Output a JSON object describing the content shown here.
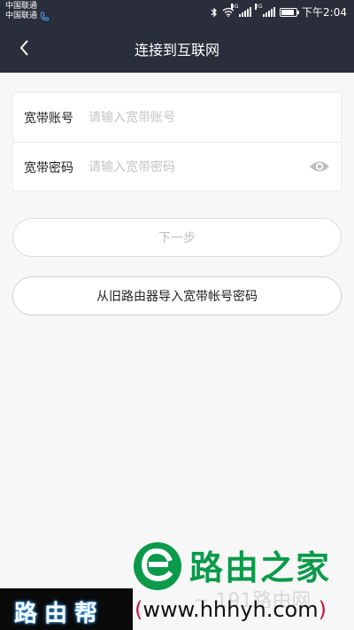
{
  "status_bar": {
    "carrier1": "中国联通",
    "carrier2": "中国联通",
    "sig1_tag": "4G",
    "sig2_tag": "2G",
    "battery_level": 0.9,
    "time": "下午2:04"
  },
  "header": {
    "title": "连接到互联网"
  },
  "form": {
    "account_label": "宽带账号",
    "account_placeholder": "请输入宽带账号",
    "account_value": "",
    "password_label": "宽带密码",
    "password_placeholder": "请输入宽带密码",
    "password_value": ""
  },
  "buttons": {
    "next_label": "下一步",
    "import_label": "从旧路由器导入宽带帐号密码"
  },
  "watermark": {
    "brand_cn": "路由之家",
    "left_brand": "路由帮",
    "url_open": "(",
    "url": "www.hhhyh.com",
    "url_close": ")",
    "ghost_text": "~ 191路由网"
  },
  "colors": {
    "bar_bg": "#2a2d3a",
    "brand_green": "#0a9a4a",
    "placeholder": "#c4c4c4"
  },
  "icons": {
    "back": "chevron-left-icon",
    "password_visibility": "eye-icon"
  }
}
